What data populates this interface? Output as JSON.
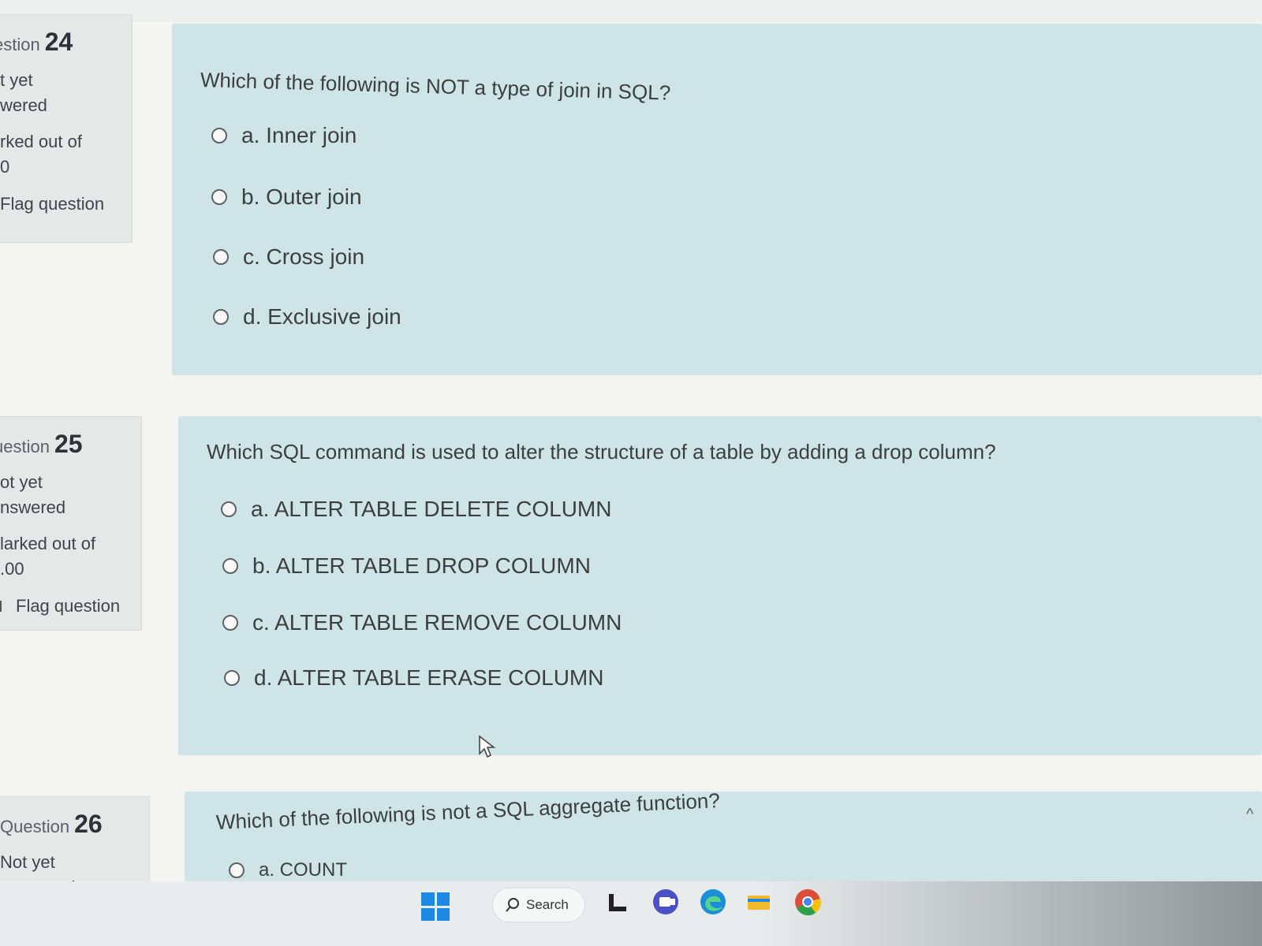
{
  "questions": [
    {
      "info": {
        "label": "estion",
        "number": "24",
        "status_lines": [
          "t yet",
          "wered"
        ],
        "marks_lines": [
          "rked out of",
          "0"
        ],
        "flag": "Flag question"
      },
      "text": "Which of the following is NOT a type of join in SQL?",
      "options": [
        "a. Inner join",
        "b. Outer join",
        "c. Cross join",
        "d. Exclusive join"
      ]
    },
    {
      "info": {
        "label": "uestion",
        "number": "25",
        "status_lines": [
          "ot yet",
          "nswered"
        ],
        "marks_lines": [
          "larked out of",
          ".00"
        ],
        "flag": "Flag question"
      },
      "text": "Which SQL command is used to alter the structure of a table by adding a drop  column?",
      "options": [
        "a. ALTER TABLE DELETE COLUMN",
        "b. ALTER TABLE DROP COLUMN",
        "c. ALTER TABLE REMOVE COLUMN",
        "d. ALTER TABLE ERASE COLUMN"
      ]
    },
    {
      "info": {
        "label": "Question",
        "number": "26",
        "status_lines": [
          "Not yet",
          "answered"
        ]
      },
      "text": "Which of the following is not a SQL aggregate function?",
      "options": [
        "a. COUNT"
      ]
    }
  ],
  "taskbar": {
    "search_label": "Search",
    "icons": [
      "windows-start-icon",
      "search-icon",
      "file-explorer-icon",
      "teams-icon",
      "edge-icon",
      "folder-icon",
      "chrome-icon"
    ]
  },
  "colors": {
    "question_box": "#cfe4e6",
    "info_box": "#e6e8e8",
    "windows_blue": "#1e88e5"
  }
}
